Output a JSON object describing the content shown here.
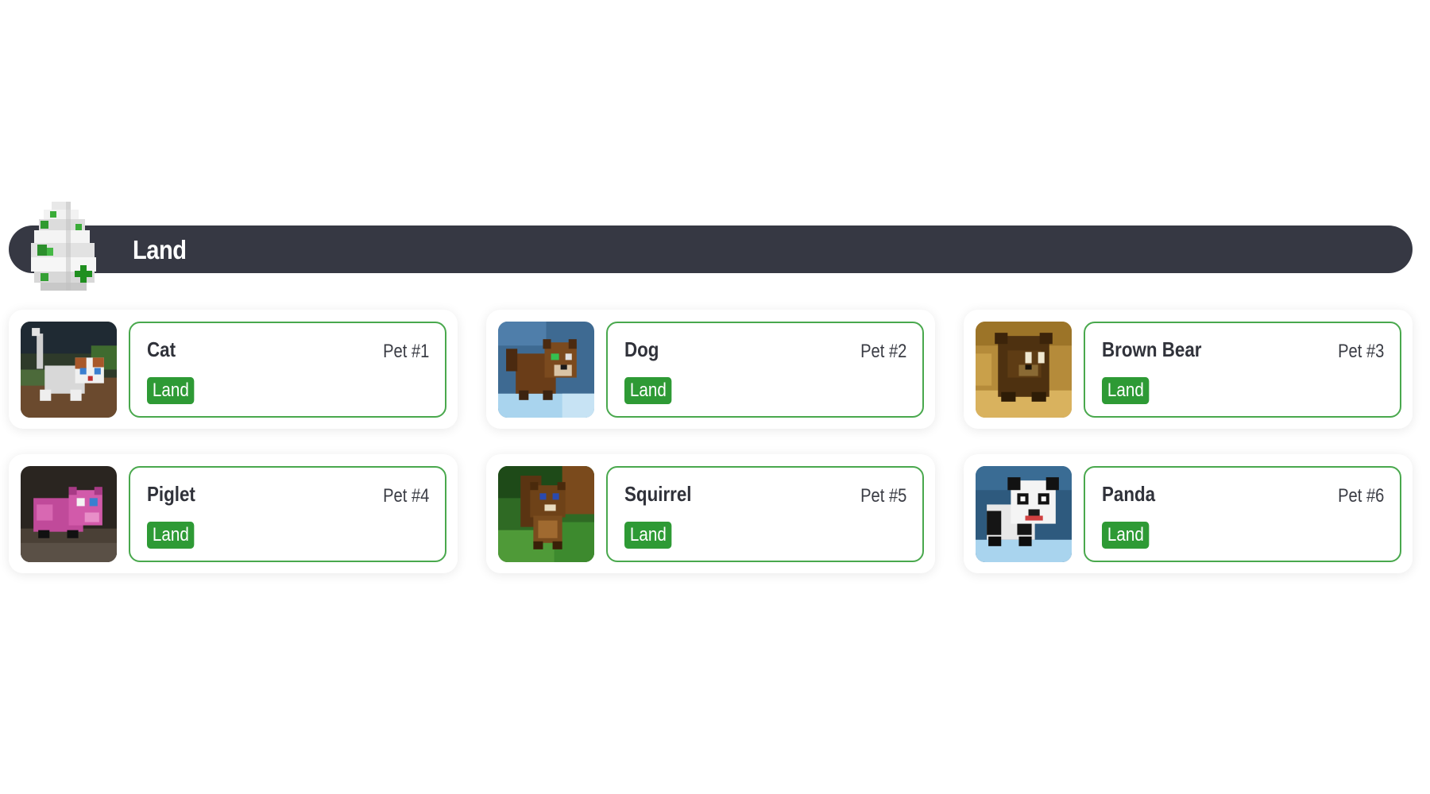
{
  "section": {
    "title": "Land",
    "icon": "land-egg-icon"
  },
  "pets": [
    {
      "name": "Cat",
      "number": "Pet #1",
      "habitat": "Land",
      "image": "cat-image"
    },
    {
      "name": "Dog",
      "number": "Pet #2",
      "habitat": "Land",
      "image": "dog-image"
    },
    {
      "name": "Brown Bear",
      "number": "Pet #3",
      "habitat": "Land",
      "image": "brown-bear-image"
    },
    {
      "name": "Piglet",
      "number": "Pet #4",
      "habitat": "Land",
      "image": "piglet-image"
    },
    {
      "name": "Squirrel",
      "number": "Pet #5",
      "habitat": "Land",
      "image": "squirrel-image"
    },
    {
      "name": "Panda",
      "number": "Pet #6",
      "habitat": "Land",
      "image": "panda-image"
    }
  ],
  "colors": {
    "header_bg": "#363843",
    "accent_green": "#2e9a35",
    "card_border": "#49a84d"
  }
}
